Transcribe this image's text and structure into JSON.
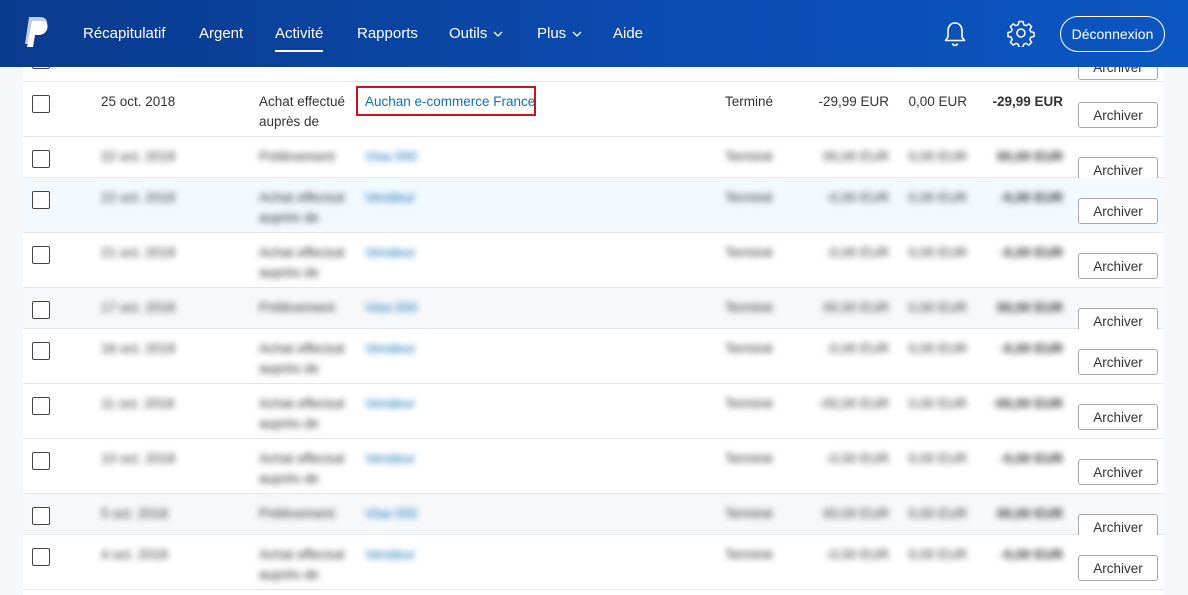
{
  "nav": {
    "items": [
      {
        "label": "Récapitulatif",
        "active": false,
        "dropdown": false
      },
      {
        "label": "Argent",
        "active": false,
        "dropdown": false
      },
      {
        "label": "Activité",
        "active": true,
        "dropdown": false
      },
      {
        "label": "Rapports",
        "active": false,
        "dropdown": false
      },
      {
        "label": "Outils",
        "active": false,
        "dropdown": true
      },
      {
        "label": "Plus",
        "active": false,
        "dropdown": true
      },
      {
        "label": "Aide",
        "active": false,
        "dropdown": false
      }
    ],
    "logout_label": "Déconnexion"
  },
  "transactions": {
    "archive_label": "Archiver",
    "rows": [
      {
        "date": "",
        "type_line1": "",
        "type_line2": "",
        "name": "",
        "status": "",
        "gross": "",
        "fee": "",
        "net": "",
        "blurred": false
      },
      {
        "date": "25 oct. 2018",
        "type_line1": "Achat effectué",
        "type_line2": "auprès de",
        "name": "Auchan e-commerce France",
        "status": "Terminé",
        "gross": "-29,99 EUR",
        "fee": "0,00 EUR",
        "net": "-29,99 EUR",
        "blurred": false,
        "highlighted": true
      },
      {
        "date": "22 oct. 2018",
        "type_line1": "Prélèvement",
        "type_line2": "",
        "name": "Visa 000",
        "status": "Terminé",
        "gross": "00,00 EUR",
        "fee": "0,00 EUR",
        "net": "00,00 EUR",
        "blurred": true
      },
      {
        "date": "22 oct. 2018",
        "type_line1": "Achat effectué",
        "type_line2": "auprès de",
        "name": "Vendeur",
        "status": "Terminé",
        "gross": "-0,00 EUR",
        "fee": "0,00 EUR",
        "net": "-0,00 EUR",
        "blurred": true
      },
      {
        "date": "21 oct. 2018",
        "type_line1": "Achat effectué",
        "type_line2": "auprès de",
        "name": "Vendeur",
        "status": "Terminé",
        "gross": "-0,00 EUR",
        "fee": "0,00 EUR",
        "net": "-0,00 EUR",
        "blurred": true
      },
      {
        "date": "17 oct. 2018",
        "type_line1": "Prélèvement",
        "type_line2": "",
        "name": "Visa 000",
        "status": "Terminé",
        "gross": "00,00 EUR",
        "fee": "0,00 EUR",
        "net": "00,00 EUR",
        "blurred": true
      },
      {
        "date": "16 oct. 2018",
        "type_line1": "Achat effectué",
        "type_line2": "auprès de",
        "name": "Vendeur",
        "status": "Terminé",
        "gross": "-0,00 EUR",
        "fee": "0,00 EUR",
        "net": "-0,00 EUR",
        "blurred": true
      },
      {
        "date": "11 oct. 2018",
        "type_line1": "Achat effectué",
        "type_line2": "auprès de",
        "name": "Vendeur",
        "status": "Terminé",
        "gross": "-00,00 EUR",
        "fee": "0,00 EUR",
        "net": "-00,00 EUR",
        "blurred": true
      },
      {
        "date": "10 oct. 2018",
        "type_line1": "Achat effectué",
        "type_line2": "auprès de",
        "name": "Vendeur",
        "status": "Terminé",
        "gross": "-0,00 EUR",
        "fee": "0,00 EUR",
        "net": "-0,00 EUR",
        "blurred": true
      },
      {
        "date": "5 oct. 2018",
        "type_line1": "Prélèvement",
        "type_line2": "",
        "name": "Visa 000",
        "status": "Terminé",
        "gross": "00,00 EUR",
        "fee": "0,00 EUR",
        "net": "00,00 EUR",
        "blurred": true
      },
      {
        "date": "4 oct. 2018",
        "type_line1": "Achat effectué",
        "type_line2": "auprès de",
        "name": "Vendeur",
        "status": "Terminé",
        "gross": "-0,00 EUR",
        "fee": "0,00 EUR",
        "net": "-0,00 EUR",
        "blurred": true
      }
    ]
  },
  "colors": {
    "header": "#0a4bb0",
    "link": "#0e70b8",
    "highlight": "#d0101b"
  }
}
